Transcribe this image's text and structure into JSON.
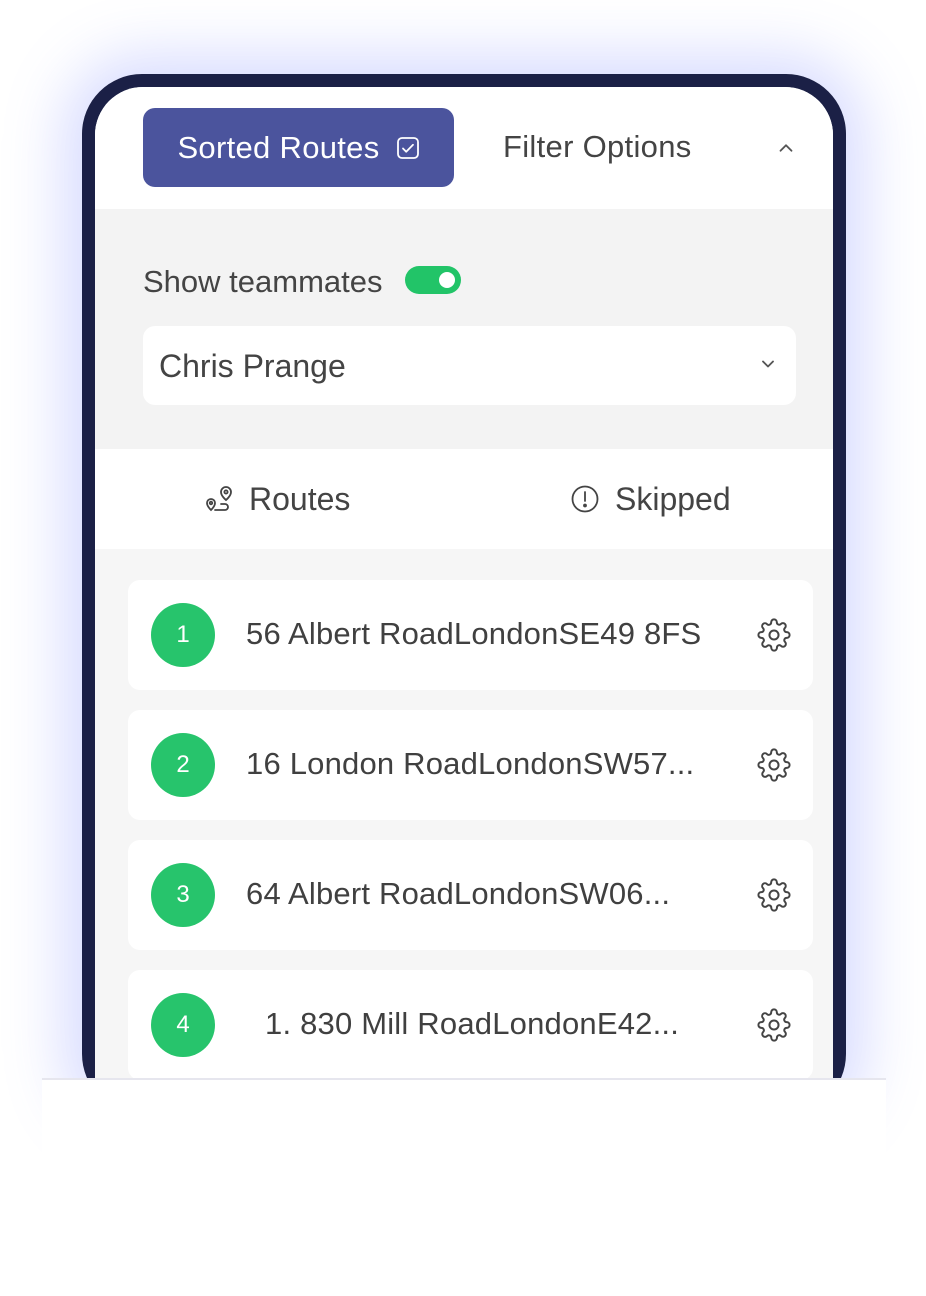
{
  "header": {
    "sorted_label": "Sorted Routes",
    "filter_label": "Filter Options"
  },
  "filters": {
    "teammates_label": "Show teammates",
    "teammates_on": true,
    "selected_teammate": "Chris Prange"
  },
  "tabs": [
    {
      "label": "Routes",
      "icon": "route-pin-icon"
    },
    {
      "label": "Skipped",
      "icon": "alert-circle-icon"
    }
  ],
  "routes": [
    {
      "number": "1",
      "address": "56 Albert RoadLondonSE49 8FS"
    },
    {
      "number": "2",
      "address": "16 London RoadLondonSW57..."
    },
    {
      "number": "3",
      "address": "64 Albert RoadLondonSW06..."
    },
    {
      "number": "4",
      "address": "1. 830 Mill RoadLondonE42..."
    }
  ],
  "colors": {
    "accent": "#4b549d",
    "toggle": "#22c468",
    "badge": "#27c46c",
    "phone_frame": "#1b2046"
  }
}
